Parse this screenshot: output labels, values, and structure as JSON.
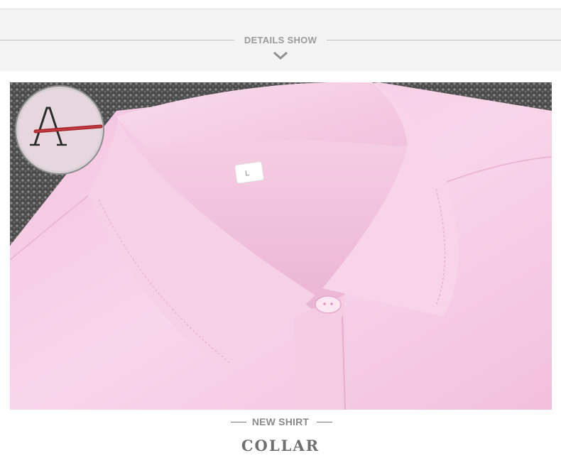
{
  "header": {
    "title": "DETAILS SHOW"
  },
  "footer": {
    "subtitle": "NEW SHIRT",
    "title": "COLLAR"
  },
  "photo": {
    "subject": "pink-shirt-collar",
    "badge_icon": "embroidered-letter-a-icon"
  },
  "colors": {
    "shirt": "#f6c8e2",
    "background_fabric": "#5e5e5e",
    "rules": "#c4c4c4"
  }
}
